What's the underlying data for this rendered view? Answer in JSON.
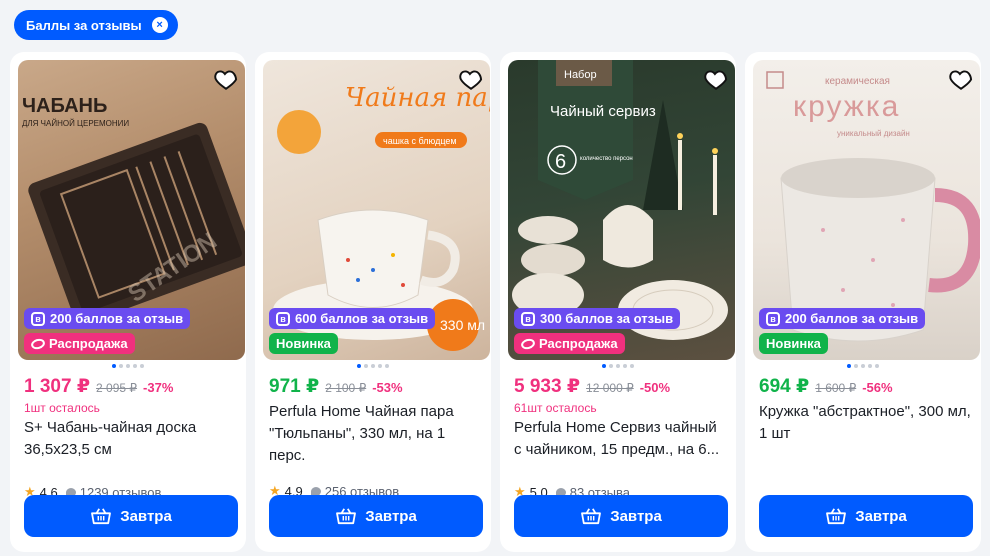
{
  "filter": {
    "label": "Баллы за отзывы"
  },
  "cards": [
    {
      "image_caption": "ЧАБАНЬ",
      "image_subcaption": "ДЛЯ ЧАЙНОЙ ЦЕРЕМОНИИ",
      "points": "200 баллов за отзыв",
      "label": "Распродажа",
      "label_type": "sale",
      "price": "1 307 ₽",
      "old_price": "2 095 ₽",
      "discount": "-37%",
      "stock": "1шт осталось",
      "title": "S+ Чабань-чайная доска 36,5х23,5 см",
      "rating": "4.6",
      "reviews": "1239 отзывов",
      "button": "Завтра",
      "price_color": "red"
    },
    {
      "image_caption": "Чайная пара",
      "image_subcaption": "чашка с блюдцем",
      "image_extra": "330 мл",
      "points": "600 баллов за отзыв",
      "label": "Новинка",
      "label_type": "new",
      "price": "971 ₽",
      "old_price": "2 100 ₽",
      "discount": "-53%",
      "stock": "",
      "title": "Perfula Home Чайная пара \"Тюльпаны\", 330 мл, на 1 перс.",
      "rating": "4.9",
      "reviews": "256 отзывов",
      "button": "Завтра",
      "price_color": "green"
    },
    {
      "image_caption": "Чайный сервиз",
      "image_tag": "Набор",
      "image_number": "6",
      "image_subcaption": "количество персон",
      "points": "300 баллов за отзыв",
      "label": "Распродажа",
      "label_type": "sale",
      "price": "5 933 ₽",
      "old_price": "12 000 ₽",
      "discount": "-50%",
      "stock": "61шт осталось",
      "title": "Perfula Home Сервиз чайный с чайником, 15 предм., на 6...",
      "rating": "5.0",
      "reviews": "83 отзыва",
      "button": "Завтра",
      "price_color": "red"
    },
    {
      "image_caption": "кружка",
      "image_tag": "керамическая",
      "image_subcaption": "уникальный дизайн",
      "points": "200 баллов за отзыв",
      "label": "Новинка",
      "label_type": "new",
      "price": "694 ₽",
      "old_price": "1 600 ₽",
      "discount": "-56%",
      "stock": "",
      "title": "Кружка \"абстрактное\", 300 мл, 1 шт",
      "rating": "",
      "reviews": "",
      "button": "Завтра",
      "price_color": "green"
    }
  ],
  "colors": {
    "accent": "#005bff",
    "sale": "#f0307e",
    "new": "#10b34a",
    "points": "#6a4cf0"
  }
}
